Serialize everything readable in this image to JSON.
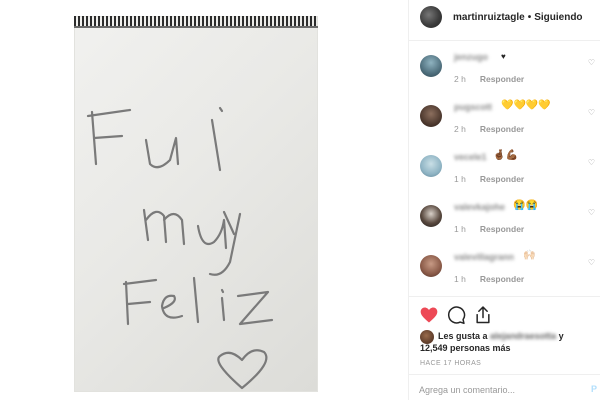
{
  "header": {
    "username": "martinruiztagle",
    "separator": "•",
    "follow_status": "Siguiendo"
  },
  "comments": [
    {
      "username": "jenzugo",
      "text": "♥",
      "time": "2 h",
      "reply_label": "Responder"
    },
    {
      "username": "pugscott",
      "text": "💛💛💛💛",
      "time": "2 h",
      "reply_label": "Responder"
    },
    {
      "username": "vecele1",
      "text": "🤞🏾💪🏾",
      "time": "1 h",
      "reply_label": "Responder"
    },
    {
      "username": "valevkajohe",
      "text": "😭😭",
      "time": "1 h",
      "reply_label": "Responder"
    },
    {
      "username": "valevillagrann",
      "text": "🙌🏻",
      "time": "1 h",
      "reply_label": "Responder"
    }
  ],
  "likes": {
    "prefix": "Les gusta a",
    "liked_by": "alejandraesotta",
    "conjunction": "y",
    "count_text": "12,549 personas más"
  },
  "post_time": "HACE 17 HORAS",
  "add_comment": {
    "placeholder": "Agrega un comentario...",
    "post_label": "P"
  },
  "colors": {
    "like_heart": "#ed4956",
    "follow_text": "#262626",
    "secondary_text": "#999999",
    "post_button": "#b2dffc"
  },
  "icons": [
    "heart-icon",
    "comment-icon",
    "share-icon",
    "comment-like-icon"
  ]
}
